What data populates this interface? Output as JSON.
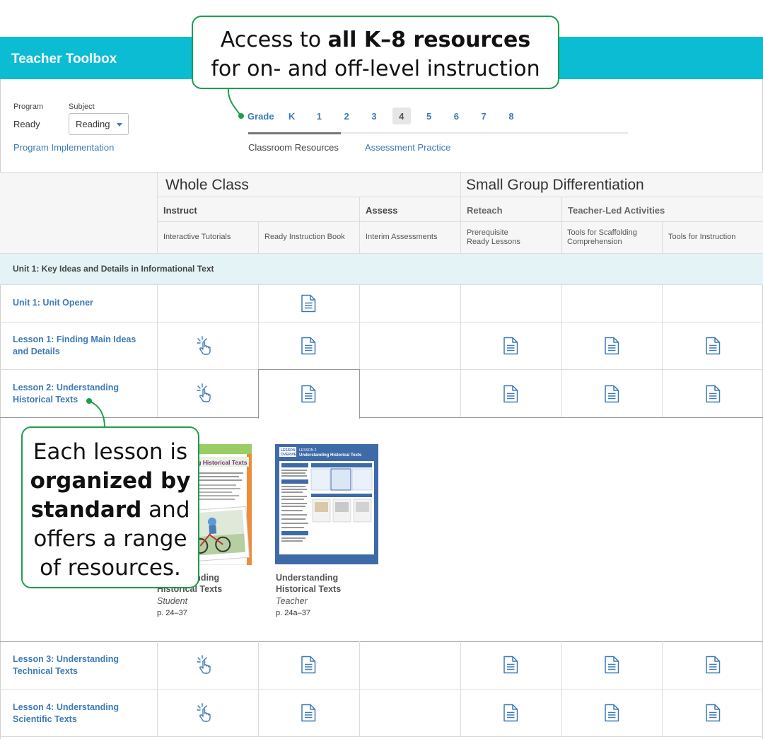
{
  "app": {
    "title": "Teacher Toolbox"
  },
  "filters": {
    "program_label": "Program",
    "program_value": "Ready",
    "subject_label": "Subject",
    "subject_value": "Reading",
    "implementation_link": "Program Implementation"
  },
  "grades": {
    "label": "Grade",
    "items": [
      "K",
      "1",
      "2",
      "3",
      "4",
      "5",
      "6",
      "7",
      "8"
    ],
    "selected": "4"
  },
  "tabs": [
    {
      "label": "Classroom Resources",
      "active": true
    },
    {
      "label": "Assessment Practice",
      "active": false
    }
  ],
  "table": {
    "groups": {
      "whole_class": "Whole Class",
      "small_group": "Small Group Differentiation"
    },
    "subgroups": {
      "instruct": "Instruct",
      "assess": "Assess",
      "reteach": "Reteach",
      "teacher_led": "Teacher-Led Activities"
    },
    "columns": {
      "interactive_tutorials": "Interactive Tutorials",
      "ready_instruction_book": "Ready Instruction Book",
      "interim_assessments": "Interim Assessments",
      "prerequisite_l1": "Prerequisite",
      "prerequisite_l2": "Ready Lessons",
      "scaffolding_l1": "Tools for Scaffolding",
      "scaffolding_l2": "Comprehension",
      "tools_instruction": "Tools for Instruction"
    },
    "unit_heading": "Unit 1: Key Ideas and Details in Informational Text",
    "rows": [
      {
        "line1": "Unit 1: Unit Opener",
        "line2": ""
      },
      {
        "line1": "Lesson 1: Finding Main Ideas",
        "line2": "and Details"
      },
      {
        "line1": "Lesson 2: Understanding",
        "line2": "Historical Texts"
      },
      {
        "line1": "Lesson 3: Understanding",
        "line2": "Technical Texts"
      },
      {
        "line1": "Lesson 4: Understanding",
        "line2": "Scientific Texts"
      }
    ]
  },
  "expanded": {
    "books": [
      {
        "title_line1": "Understanding",
        "title_line2": "Historical Texts",
        "role": "Student",
        "pages": "p. 24–37"
      },
      {
        "title_line1": "Understanding",
        "title_line2": "Historical Texts",
        "role": "Teacher",
        "pages": "p. 24a–37"
      }
    ],
    "student_cover": {
      "heading": "ng Historical Texts"
    },
    "teacher_cover": {
      "badge_l1": "LESSON",
      "badge_l2": "OVERVIEW",
      "lesson_num": "LESSON 2",
      "heading": "Understanding Historical Texts"
    }
  },
  "callouts": {
    "top_pre": "Access to ",
    "top_bold": "all K–8 resources",
    "top_line2": "for on- and off-level instruction",
    "left_l1": "Each lesson is",
    "left_bold1": "organized by",
    "left_bold2": "standard",
    "left_l3_rest": " and",
    "left_l4": "offers a range",
    "left_l5": "of resources."
  },
  "colors": {
    "header": "#0cbcd3",
    "link": "#3d7ab8",
    "callout_border": "#1aa04a",
    "unit_band": "#e3f3f6"
  },
  "icons": {
    "document": "document-icon",
    "interactive": "tap-hand-icon"
  }
}
